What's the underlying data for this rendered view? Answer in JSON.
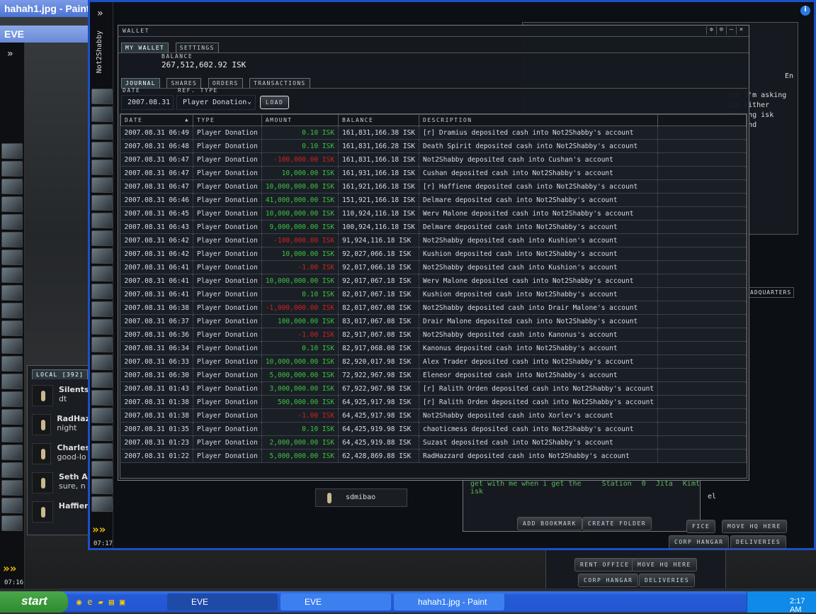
{
  "windows": {
    "paint_title": "hahah1.jpg - Paint",
    "eve_title": "EVE"
  },
  "wallet": {
    "title": "WALLET",
    "tabs": [
      "MY WALLET",
      "SETTINGS"
    ],
    "character": "Not2Shabby",
    "balance_label": "BALANCE",
    "balance": "267,512,602.92 ISK",
    "subtabs": [
      "JOURNAL",
      "SHARES",
      "ORDERS",
      "TRANSACTIONS"
    ],
    "filter": {
      "date_label": "DATE",
      "date": "2007.08.31",
      "ref_label": "REF. TYPE",
      "ref": "Player Donation",
      "load": "LOAD"
    },
    "columns": [
      "DATE",
      "TYPE",
      "AMOUNT",
      "BALANCE",
      "DESCRIPTION"
    ],
    "rows": [
      [
        "2007.08.31 06:49",
        "Player Donation",
        "0.10",
        "161,831,166.38 ISK",
        "[r] Dramius deposited cash into Not2Shabby's account"
      ],
      [
        "2007.08.31 06:48",
        "Player Donation",
        "0.10",
        "161,831,166.28 ISK",
        "Death Spirit deposited cash into Not2Shabby's account"
      ],
      [
        "2007.08.31 06:47",
        "Player Donation",
        "-100,000.00",
        "161,831,166.18 ISK",
        "Not2Shabby deposited cash into Cushan's account"
      ],
      [
        "2007.08.31 06:47",
        "Player Donation",
        "10,000.00",
        "161,931,166.18 ISK",
        "Cushan deposited cash into Not2Shabby's account"
      ],
      [
        "2007.08.31 06:47",
        "Player Donation",
        "10,000,000.00",
        "161,921,166.18 ISK",
        "[r] Haffiene deposited cash into Not2Shabby's account"
      ],
      [
        "2007.08.31 06:46",
        "Player Donation",
        "41,000,000.00",
        "151,921,166.18 ISK",
        "Delmare deposited cash into Not2Shabby's account"
      ],
      [
        "2007.08.31 06:45",
        "Player Donation",
        "10,000,000.00",
        "110,924,116.18 ISK",
        "Werv Malone deposited cash into Not2Shabby's account"
      ],
      [
        "2007.08.31 06:43",
        "Player Donation",
        "9,000,000.00",
        "100,924,116.18 ISK",
        "Delmare deposited cash into Not2Shabby's account"
      ],
      [
        "2007.08.31 06:42",
        "Player Donation",
        "-100,000.00",
        "91,924,116.18 ISK",
        "Not2Shabby deposited cash into Kushion's account"
      ],
      [
        "2007.08.31 06:42",
        "Player Donation",
        "10,000.00",
        "92,027,066.18 ISK",
        "Kushion deposited cash into Not2Shabby's account"
      ],
      [
        "2007.08.31 06:41",
        "Player Donation",
        "-1.00",
        "92,017,066.18 ISK",
        "Not2Shabby deposited cash into Kushion's account"
      ],
      [
        "2007.08.31 06:41",
        "Player Donation",
        "10,000,000.00",
        "92,017,067.18 ISK",
        "Werv Malone deposited cash into Not2Shabby's account"
      ],
      [
        "2007.08.31 06:41",
        "Player Donation",
        "0.10",
        "82,017,067.18 ISK",
        "Kushion deposited cash into Not2Shabby's account"
      ],
      [
        "2007.08.31 06:38",
        "Player Donation",
        "-1,000,000.00",
        "82,017,067.08 ISK",
        "Not2Shabby deposited cash into Drair Malone's account"
      ],
      [
        "2007.08.31 06:37",
        "Player Donation",
        "100,000.00",
        "83,017,067.08 ISK",
        "Drair Malone deposited cash into Not2Shabby's account"
      ],
      [
        "2007.08.31 06:36",
        "Player Donation",
        "-1.00",
        "82,917,067.08 ISK",
        "Not2Shabby deposited cash into Kanonus's account"
      ],
      [
        "2007.08.31 06:34",
        "Player Donation",
        "0.10",
        "82,917,068.08 ISK",
        "Kanonus deposited cash into Not2Shabby's account"
      ],
      [
        "2007.08.31 06:33",
        "Player Donation",
        "10,000,000.00",
        "82,920,017.98 ISK",
        "Alex Trader deposited cash into Not2Shabby's account"
      ],
      [
        "2007.08.31 06:30",
        "Player Donation",
        "5,000,000.00",
        "72,922,967.98 ISK",
        "Eleneor deposited cash into Not2Shabby's account"
      ],
      [
        "2007.08.31 01:43",
        "Player Donation",
        "3,000,000.00",
        "67,922,967.98 ISK",
        "[r] Ralith Orden deposited cash into Not2Shabby's account"
      ],
      [
        "2007.08.31 01:38",
        "Player Donation",
        "500,000.00",
        "64,925,917.98 ISK",
        "[r] Ralith Orden deposited cash into Not2Shabby's account"
      ],
      [
        "2007.08.31 01:38",
        "Player Donation",
        "-1.00",
        "64,425,917.98 ISK",
        "Not2Shabby deposited cash into Xorlev's account"
      ],
      [
        "2007.08.31 01:35",
        "Player Donation",
        "0.10",
        "64,425,919.98 ISK",
        "chaoticmess deposited cash into Not2Shabby's account"
      ],
      [
        "2007.08.31 01:23",
        "Player Donation",
        "2,000,000.00",
        "64,425,919.88 ISK",
        "Suzast deposited cash into Not2Shabby's account"
      ],
      [
        "2007.08.31 01:22",
        "Player Donation",
        "5,000,000.00",
        "62,428,869.88 ISK",
        "RadHazzard deposited cash into Not2Shabby's account"
      ]
    ],
    "currency": "ISK"
  },
  "local": {
    "tab": "LOCAL [392]",
    "members": [
      {
        "name": "Silents",
        "msg": "dt"
      },
      {
        "name": "RadHaz",
        "msg": "night"
      },
      {
        "name": "Charles",
        "msg": "good-lo"
      },
      {
        "name": "Seth A",
        "msg": "sure, n"
      },
      {
        "name": "Haffien",
        "msg": ""
      }
    ]
  },
  "chat_partial": [
    "fer I'm asking",
    "can either",
    "naining isk",
    "respond"
  ],
  "chat_lang": "En",
  "other_chat_member": "sdmibao",
  "bookmark": {
    "row": [
      "get with me when i get the isk",
      "Station",
      "0",
      "Jita",
      "Kimt"
    ],
    "add": "ADD BOOKMARK",
    "create": "CREATE FOLDER",
    "partial": "el"
  },
  "station": {
    "headquarters": "ADQUARTERS",
    "rent": "RENT OFFICE",
    "rent_partial": "FICE",
    "move_hq": "MOVE HQ HERE",
    "corp_hangar": "CORP HANGAR",
    "deliveries": "DELIVERIES"
  },
  "clocks": {
    "front": "07:17",
    "back": "07:16"
  },
  "taskbar": {
    "start": "start",
    "tasks": [
      "EVE",
      "EVE",
      "hahah1.jpg - Paint"
    ],
    "time": "2:17 AM"
  },
  "colors": {
    "positive": "#3dc33d",
    "negative": "#d02020",
    "xp_blue": "#1d4fc8"
  }
}
